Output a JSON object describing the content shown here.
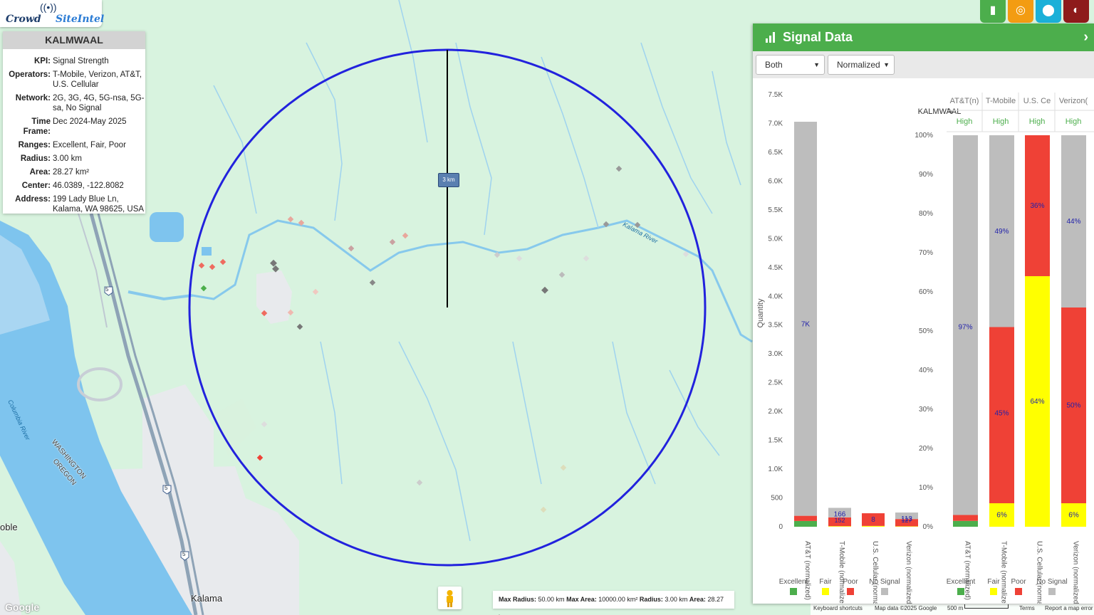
{
  "app": {
    "logo_part1": "Crowd",
    "logo_part2": "SiteIntel"
  },
  "info": {
    "title": "KALMWAAL",
    "rows": [
      {
        "k": "KPI:",
        "v": "Signal Strength"
      },
      {
        "k": "Operators:",
        "v": "T-Mobile, Verizon, AT&T, U.S. Cellular"
      },
      {
        "k": "Network:",
        "v": "2G, 3G, 4G, 5G-nsa, 5G-sa, No Signal"
      },
      {
        "k": "Time Frame:",
        "v": "Dec 2024-May 2025"
      },
      {
        "k": "Ranges:",
        "v": "Excellent, Fair, Poor"
      },
      {
        "k": "Radius:",
        "v": "3.00 km"
      },
      {
        "k": "Area:",
        "v": "28.27 km²"
      },
      {
        "k": "Center:",
        "v": "46.0389, -122.8082"
      },
      {
        "k": "Address:",
        "v": "199 Lady Blue Ln, Kalama, WA 98625, USA"
      }
    ]
  },
  "map": {
    "distance_label": "3 km",
    "labels": {
      "city": "Kalama",
      "river_kalama": "Kalama River",
      "river_columbia": "Columbia River",
      "state_line_1": "WASHINGTON",
      "state_line_2": "OREGON",
      "partial_place": "oble"
    },
    "shields": [
      "5",
      "5",
      "5"
    ],
    "radius_info": {
      "max_radius_label": "Max Radius:",
      "max_radius": "50.00 km",
      "max_area_label": "Max Area:",
      "max_area": "10000.00 km²",
      "radius_label": "Radius:",
      "radius": "3.00 km",
      "area_label": "Area:",
      "area": "28.27 km²"
    },
    "google": "Google",
    "attribution": {
      "shortcuts": "Keyboard shortcuts",
      "data": "Map data ©2025 Google",
      "scale": "500 m",
      "terms": "Terms",
      "report": "Report a map error"
    }
  },
  "top_buttons": [
    {
      "name": "chart-icon",
      "color": "#4cae4c",
      "glyph": "▮"
    },
    {
      "name": "target-icon",
      "color": "#f39c12",
      "glyph": "◎"
    },
    {
      "name": "pin-icon",
      "color": "#1ab0d8",
      "glyph": "⬤"
    },
    {
      "name": "globe-icon",
      "color": "#8e1b1b",
      "glyph": "◐"
    }
  ],
  "panel": {
    "title": "Signal Data",
    "select_direction": "Both",
    "select_mode": "Normalized",
    "chart_title": "KALMWAAL",
    "table_headers": [
      "AT&T(n)",
      "T-Mobile",
      "U.S. Ce",
      "Verizon("
    ],
    "table_values": [
      "High",
      "High",
      "High",
      "High"
    ],
    "legend": [
      {
        "label": "Excellent",
        "color": "#4cae4c"
      },
      {
        "label": "Fair",
        "color": "#ffff00"
      },
      {
        "label": "Poor",
        "color": "#ef4136"
      },
      {
        "label": "No Signal",
        "color": "#bdbdbd"
      }
    ]
  },
  "chart_data": [
    {
      "type": "bar",
      "stacked": true,
      "title": "KALMWAAL",
      "ylabel": "Quantity",
      "ylim": [
        0,
        7500
      ],
      "yticks": [
        "0",
        "500",
        "1.0K",
        "1.5K",
        "2.0K",
        "2.5K",
        "3.0K",
        "3.5K",
        "4.0K",
        "4.5K",
        "5.0K",
        "5.5K",
        "6.0K",
        "6.5K",
        "7.0K",
        "7.5K"
      ],
      "categories": [
        "AT&T (normalized)",
        "T-Mobile (normalized)",
        "U.S. Cellular (normalized)",
        "Verizon (normalized)"
      ],
      "series": [
        {
          "name": "Excellent",
          "values": [
            100,
            0,
            0,
            0
          ]
        },
        {
          "name": "Fair",
          "values": [
            0,
            10,
            14,
            7
          ]
        },
        {
          "name": "Poor",
          "values": [
            90,
            152,
            220,
            127
          ]
        },
        {
          "name": "No Signal",
          "values": [
            6840,
            166,
            0,
            113
          ]
        }
      ],
      "bar_labels": [
        "7K",
        "166",
        "8",
        "113"
      ],
      "bar_sublabels": [
        "",
        "152",
        "",
        "127"
      ]
    },
    {
      "type": "bar",
      "stacked": true,
      "ylim": [
        0,
        100
      ],
      "yticks": [
        "0%",
        "10%",
        "20%",
        "30%",
        "40%",
        "50%",
        "60%",
        "70%",
        "80%",
        "90%",
        "100%"
      ],
      "categories": [
        "AT&T (normalized)",
        "T-Mobile (normalized)",
        "U.S. Cellular (normalized)",
        "Verizon (normalized)"
      ],
      "series": [
        {
          "name": "Excellent",
          "values": [
            1.5,
            0,
            0,
            0
          ]
        },
        {
          "name": "Fair",
          "values": [
            0,
            6,
            64,
            6
          ]
        },
        {
          "name": "Poor",
          "values": [
            1.5,
            45,
            36,
            50
          ]
        },
        {
          "name": "No Signal",
          "values": [
            97,
            49,
            0,
            44
          ]
        }
      ],
      "segment_labels": [
        {
          "cat": 0,
          "label": "97%",
          "at": 51
        },
        {
          "cat": 1,
          "label": "49%",
          "at": 75.5
        },
        {
          "cat": 1,
          "label": "45%",
          "at": 29
        },
        {
          "cat": 1,
          "label": "6%",
          "at": 3
        },
        {
          "cat": 2,
          "label": "36%",
          "at": 82
        },
        {
          "cat": 2,
          "label": "64%",
          "at": 32
        },
        {
          "cat": 3,
          "label": "44%",
          "at": 78
        },
        {
          "cat": 3,
          "label": "50%",
          "at": 31
        },
        {
          "cat": 3,
          "label": "6%",
          "at": 3
        }
      ]
    }
  ]
}
